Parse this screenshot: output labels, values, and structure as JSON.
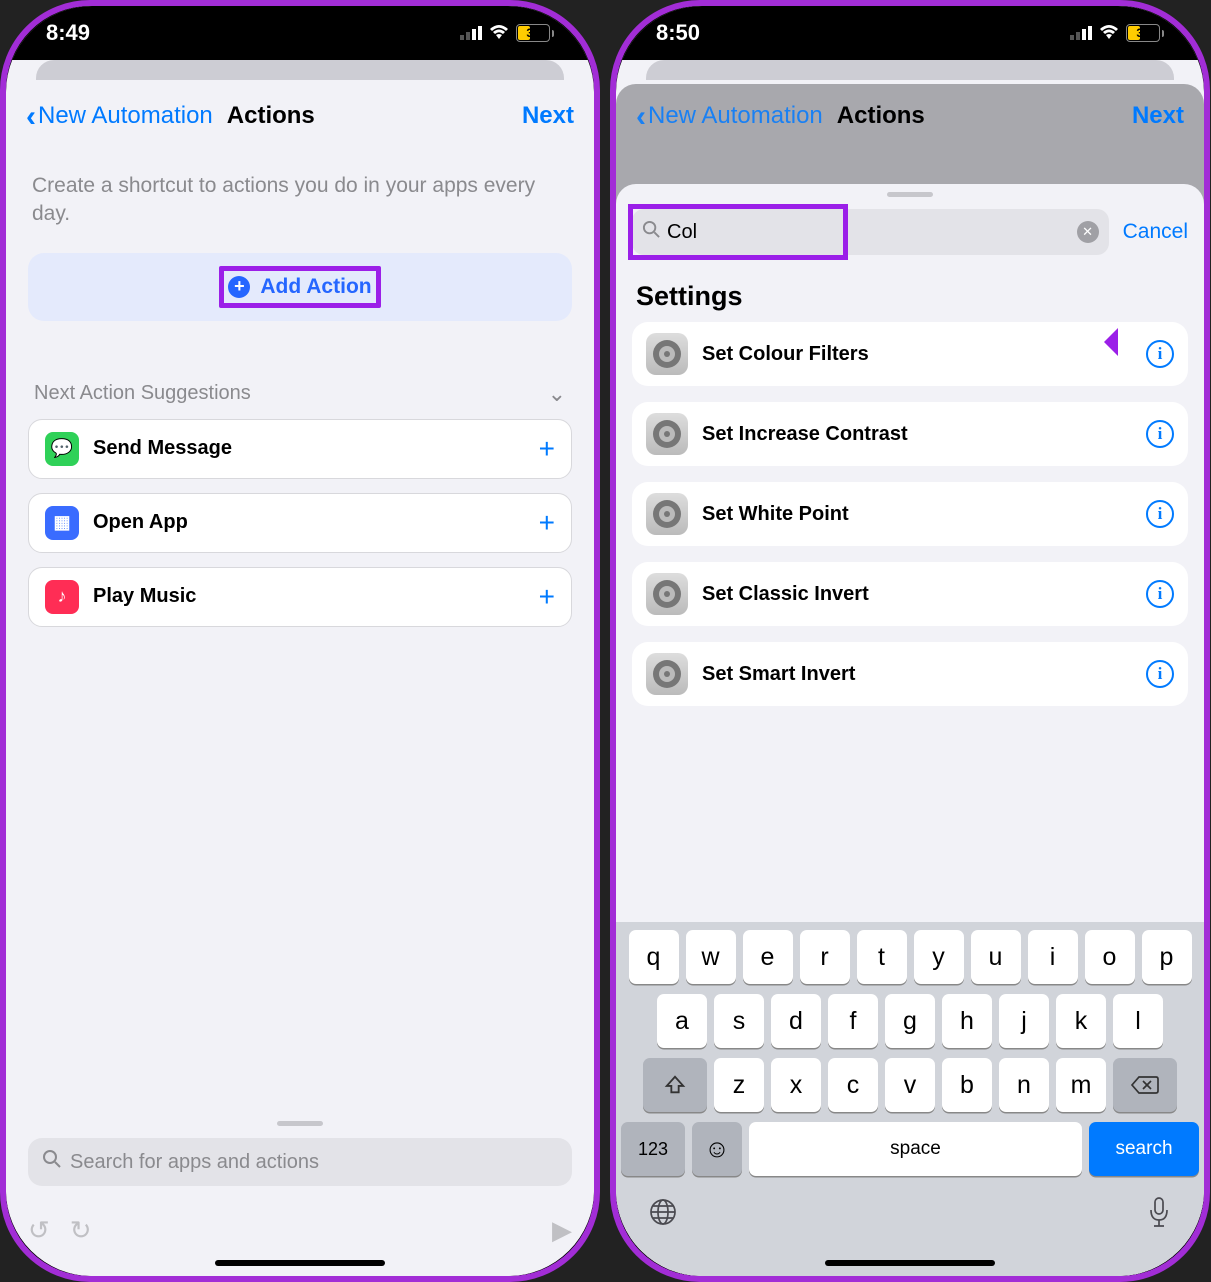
{
  "left": {
    "time": "8:49",
    "battery": "37",
    "nav_back": "New Automation",
    "nav_title": "Actions",
    "nav_next": "Next",
    "desc": "Create a shortcut to actions you do in your apps every day.",
    "add_action": "Add Action",
    "sugg_header": "Next Action Suggestions",
    "suggestions": [
      {
        "label": "Send Message"
      },
      {
        "label": "Open App"
      },
      {
        "label": "Play Music"
      }
    ],
    "search_placeholder": "Search for apps and actions"
  },
  "right": {
    "time": "8:50",
    "battery": "37",
    "nav_back": "New Automation",
    "nav_title": "Actions",
    "nav_next": "Next",
    "search_value": "Col",
    "cancel": "Cancel",
    "section": "Settings",
    "results": [
      {
        "label": "Set Colour Filters",
        "annotated": true
      },
      {
        "label": "Set Increase Contrast"
      },
      {
        "label": "Set White Point"
      },
      {
        "label": "Set Classic Invert"
      },
      {
        "label": "Set Smart Invert"
      }
    ],
    "keyboard": {
      "row1": [
        "q",
        "w",
        "e",
        "r",
        "t",
        "y",
        "u",
        "i",
        "o",
        "p"
      ],
      "row2": [
        "a",
        "s",
        "d",
        "f",
        "g",
        "h",
        "j",
        "k",
        "l"
      ],
      "row3": [
        "z",
        "x",
        "c",
        "v",
        "b",
        "n",
        "m"
      ],
      "num": "123",
      "space": "space",
      "search": "search"
    }
  }
}
